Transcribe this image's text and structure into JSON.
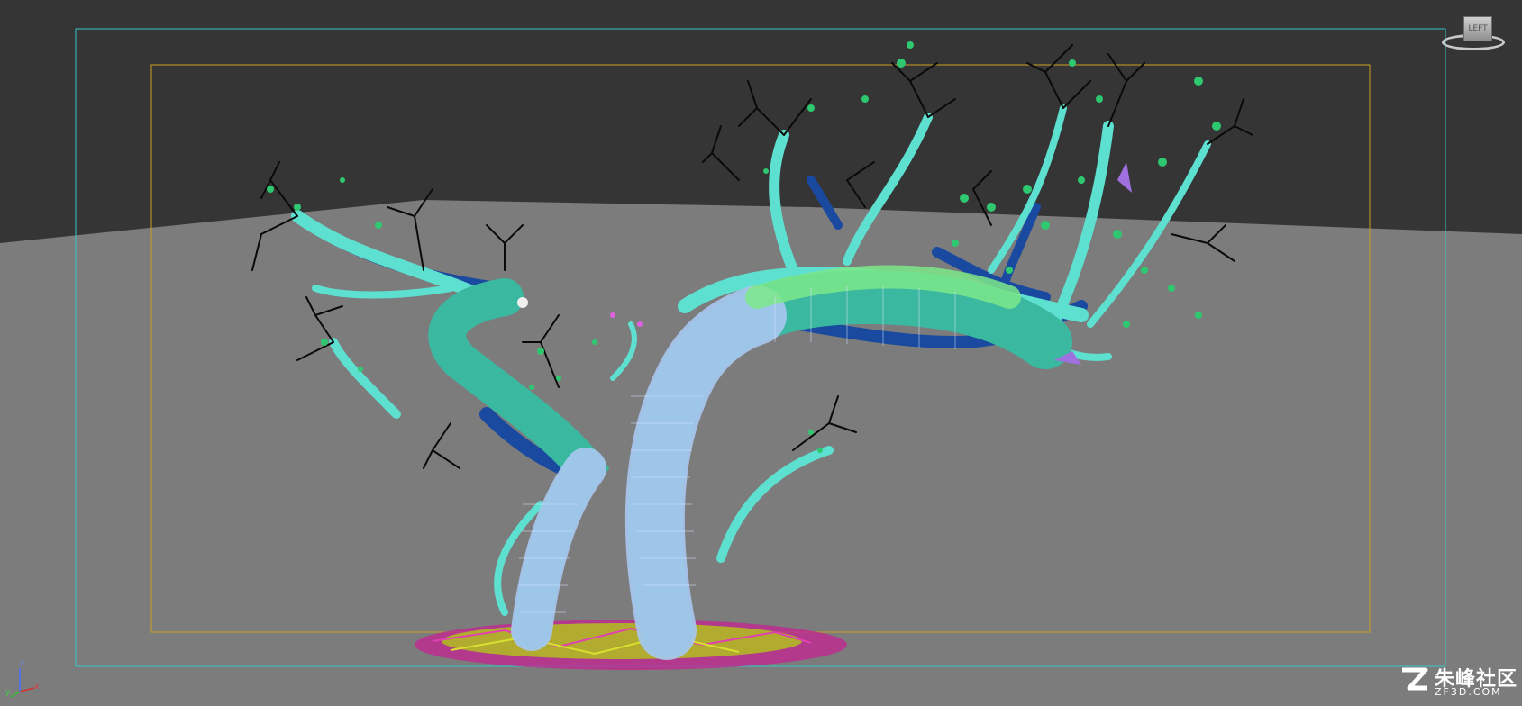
{
  "viewport": {
    "background_color": "#353535",
    "ground_color": "#7c7c7c",
    "safe_frame_outer_color": "#38c6c6",
    "safe_frame_inner_color": "#c8a020"
  },
  "tree_model": {
    "trunk_wire_color": "#a8c8f0",
    "trunk_mesh_color": "#3ab8a0",
    "branch_color": "#5ee0d0",
    "branch_shadow_color": "#1a4aa0",
    "mesh_wire_color": "#7ce88a",
    "leaf_color": "#2ec870",
    "twig_color": "#0a0a0a",
    "ground_cover_colors": [
      "#b0c020",
      "#c02890"
    ]
  },
  "viewcube": {
    "face_label": "LEFT",
    "icon": "viewcube-icon"
  },
  "axis_gizmo": {
    "z_label": "z",
    "y_label": "y",
    "x_label": "x"
  },
  "watermark": {
    "icon": "zf3d-logo-icon",
    "name": "朱峰社区",
    "url": "ZF3D.COM"
  }
}
